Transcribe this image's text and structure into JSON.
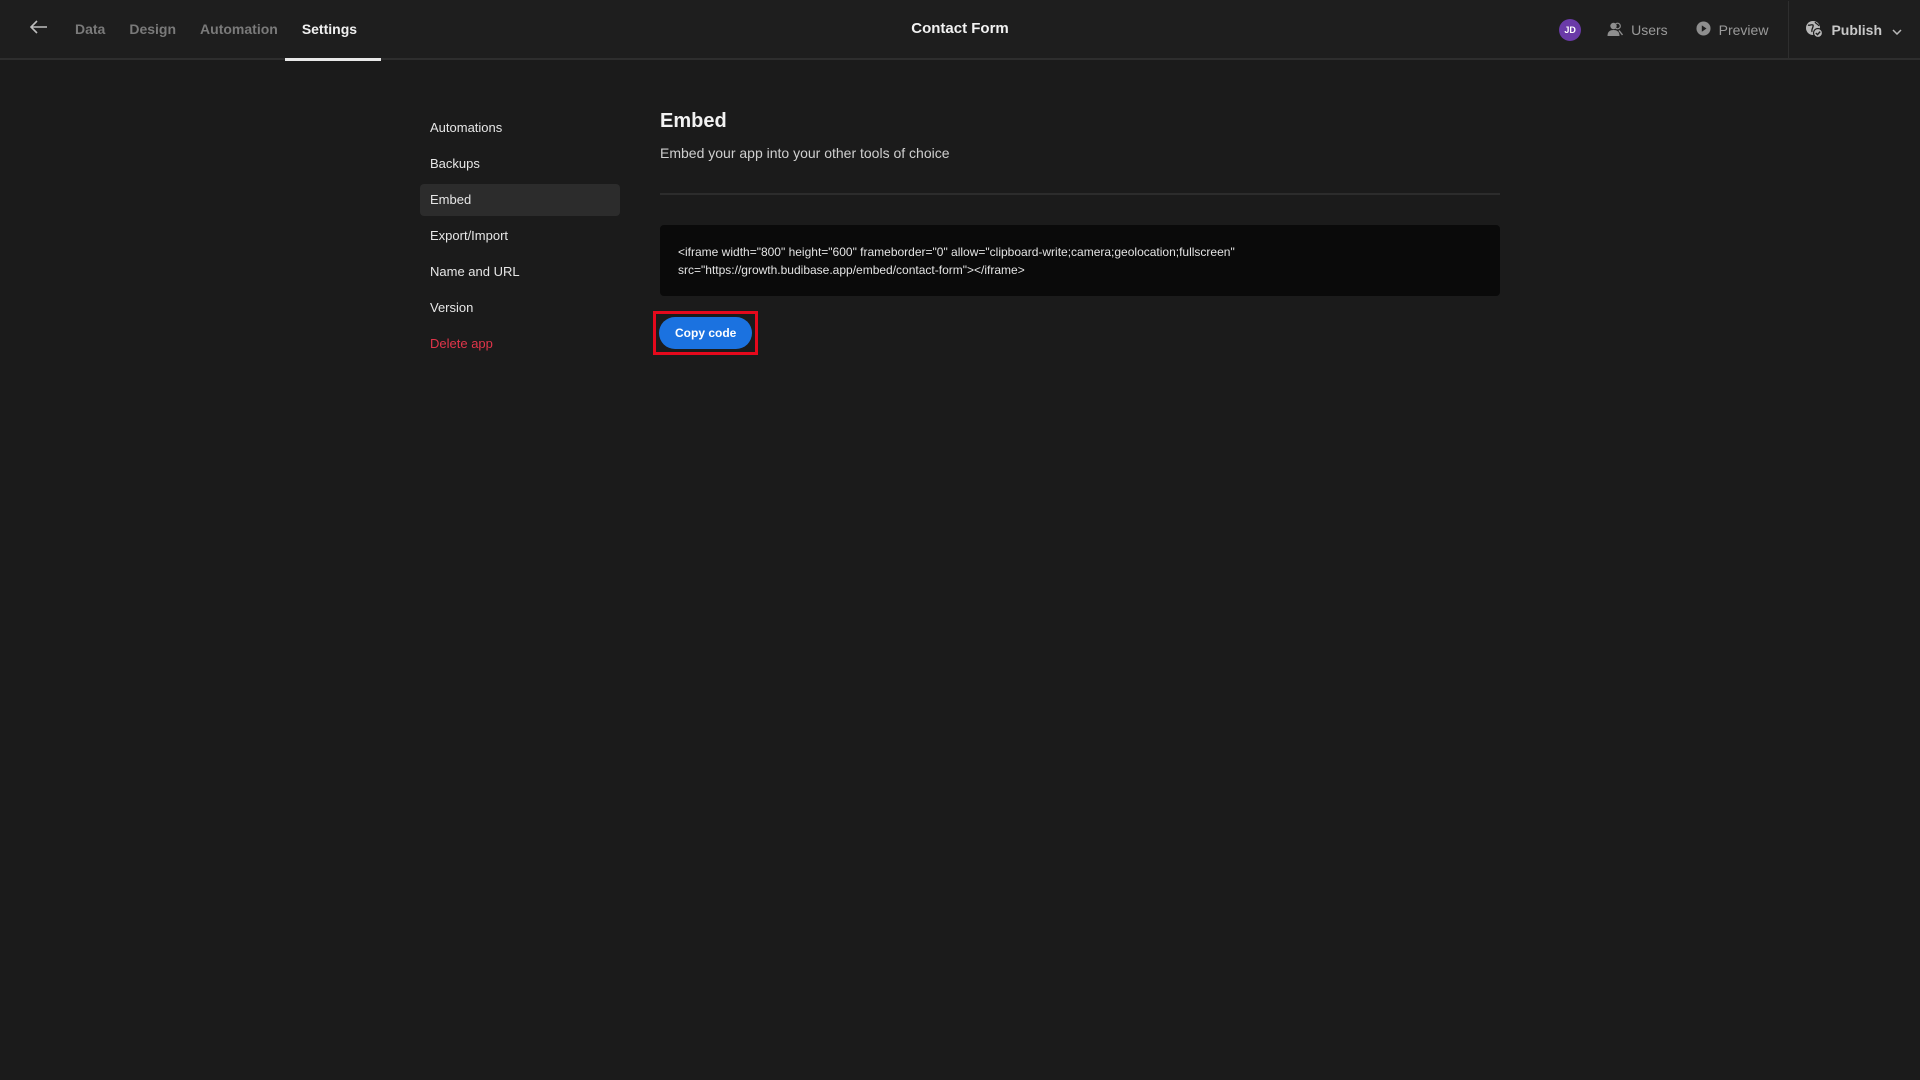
{
  "topbar": {
    "back_icon": "arrow-left-icon",
    "tabs": [
      {
        "label": "Data",
        "active": false
      },
      {
        "label": "Design",
        "active": false
      },
      {
        "label": "Automation",
        "active": false
      },
      {
        "label": "Settings",
        "active": true
      }
    ],
    "app_title": "Contact Form",
    "avatar_initials": "JD",
    "avatar_color": "#6a3aa8",
    "users_label": "Users",
    "preview_label": "Preview",
    "publish_label": "Publish"
  },
  "settings_nav": {
    "items": [
      {
        "label": "Automations"
      },
      {
        "label": "Backups"
      },
      {
        "label": "Embed",
        "active": true
      },
      {
        "label": "Export/Import"
      },
      {
        "label": "Name and URL"
      },
      {
        "label": "Version"
      },
      {
        "label": "Delete app",
        "danger": true
      }
    ]
  },
  "embed": {
    "title": "Embed",
    "subtitle": "Embed your app into your other tools of choice",
    "code_line1": "<iframe width=\"800\" height=\"600\" frameborder=\"0\" allow=\"clipboard-write;camera;geolocation;fullscreen\"",
    "code_line2": "src=\"https://growth.budibase.app/embed/contact-form\"></iframe>",
    "copy_button_label": "Copy code",
    "accent_color": "#1b72e0",
    "highlight_color": "#e5091c"
  }
}
